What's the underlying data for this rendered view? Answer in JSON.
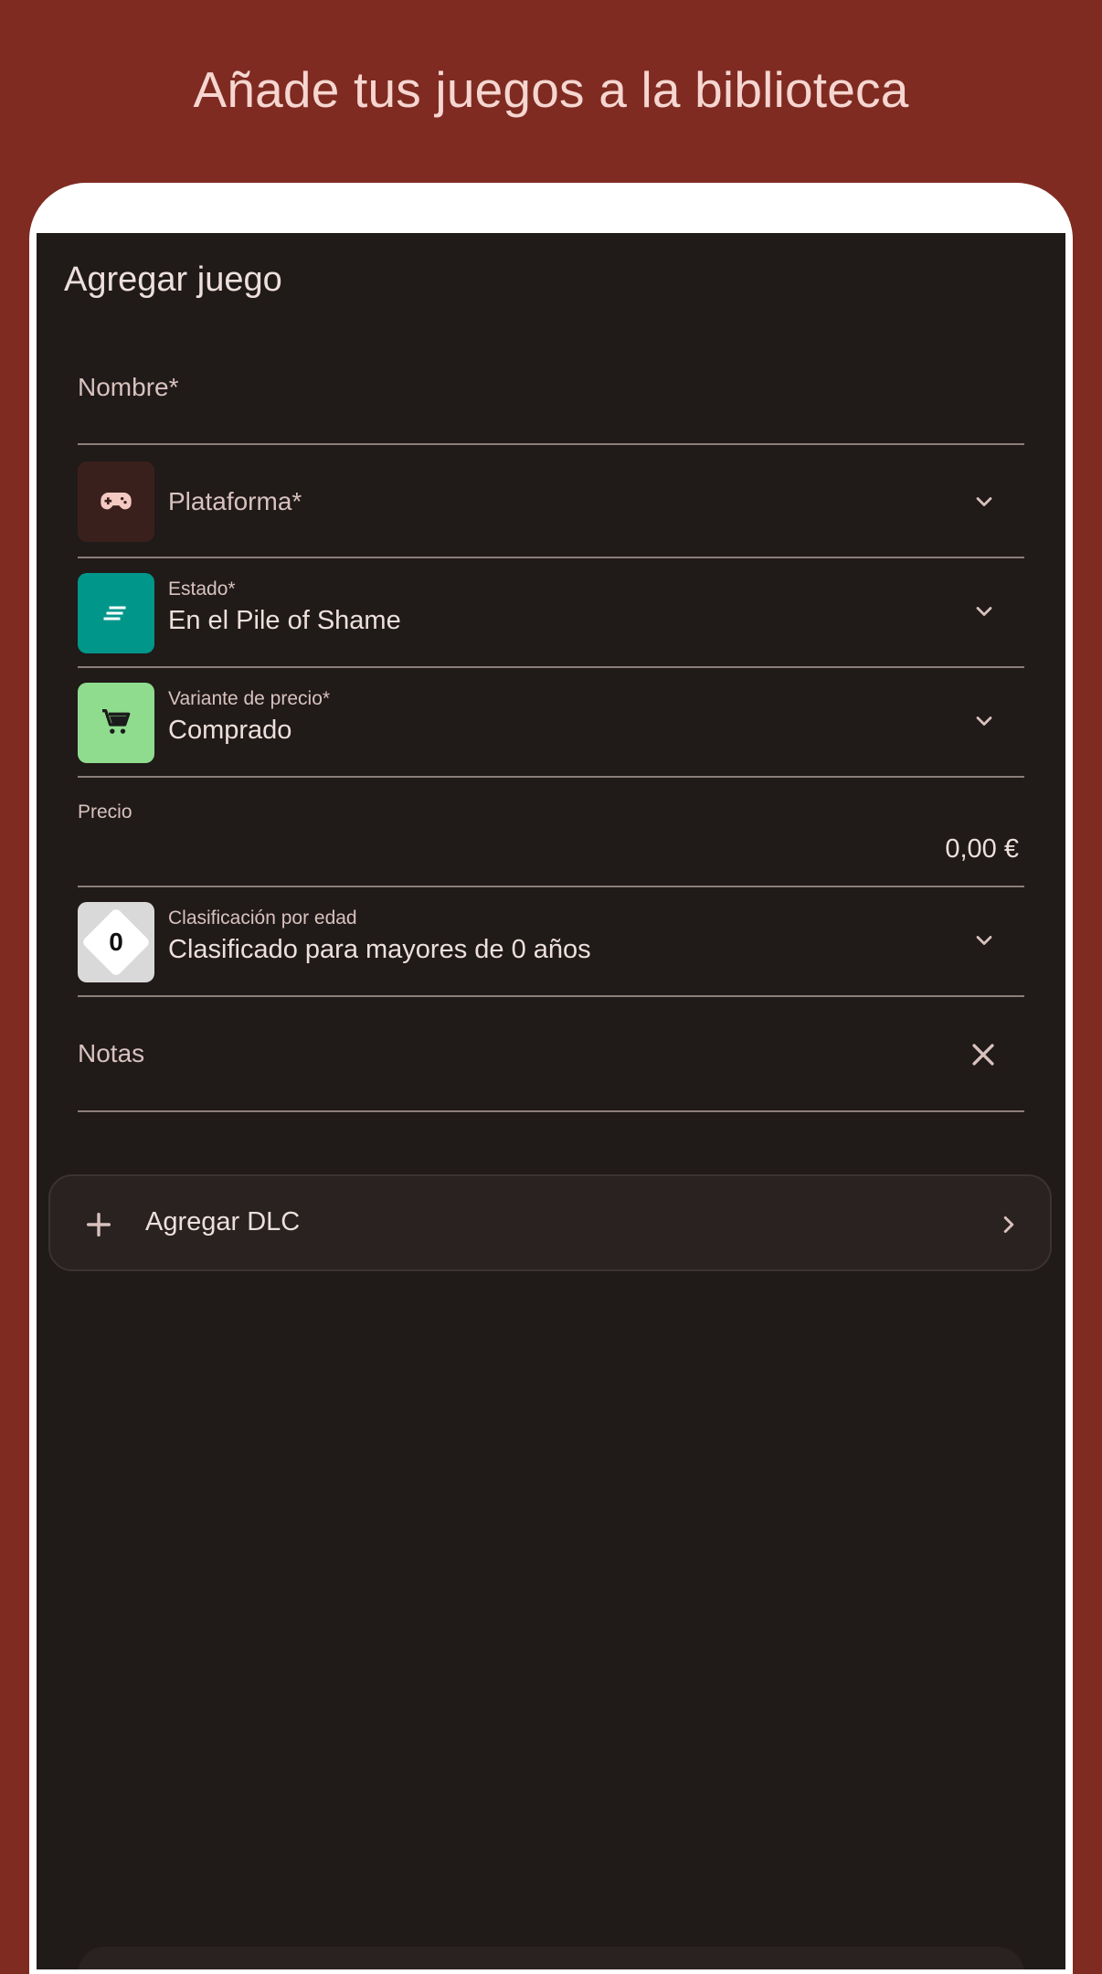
{
  "headline": "Añade tus juegos a la biblioteca",
  "screen": {
    "title": "Agregar juego"
  },
  "fields": {
    "nombre": {
      "label": "Nombre*"
    },
    "plataforma": {
      "label": "Plataforma*",
      "icon": "gamepad-icon"
    },
    "estado": {
      "label": "Estado*",
      "value": "En el Pile of Shame",
      "icon": "notes-icon"
    },
    "variante": {
      "label": "Variante de precio*",
      "value": "Comprado",
      "icon": "cart-icon"
    },
    "precio": {
      "label": "Precio",
      "value": "0,00 €"
    },
    "clasificacion": {
      "label": "Clasificación por edad",
      "value": "Clasificado para mayores de 0 años",
      "badge": "0"
    },
    "notas": {
      "label": "Notas"
    }
  },
  "dlc": {
    "label": "Agregar DLC"
  },
  "colors": {
    "background": "#7f2b22",
    "screen": "#201a18",
    "estado_icon": "#00968a",
    "variante_icon": "#8fdc8f",
    "plataforma_icon": "#3a201d"
  }
}
